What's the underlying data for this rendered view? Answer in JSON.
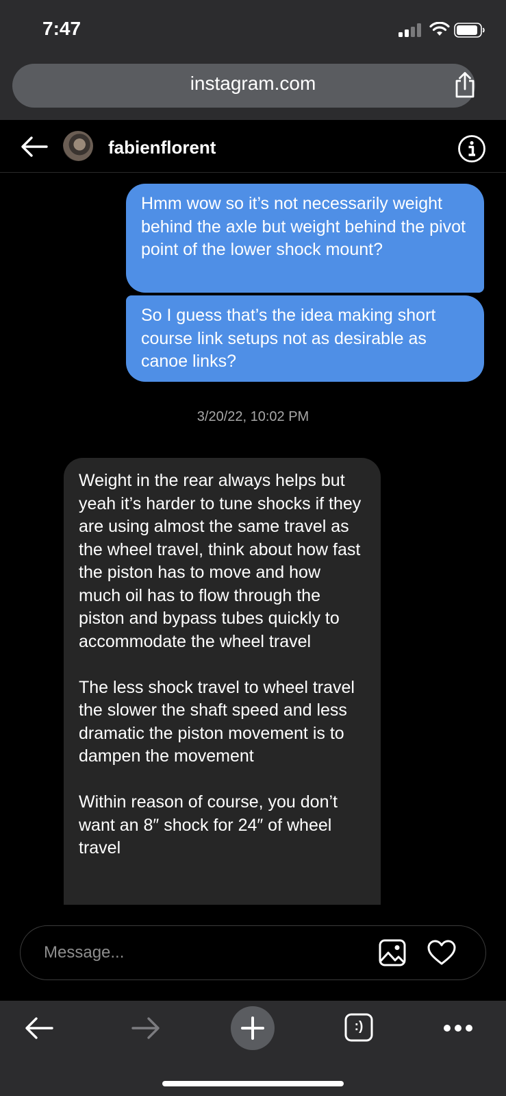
{
  "status_bar": {
    "time": "7:47"
  },
  "browser": {
    "url": "instagram.com"
  },
  "header": {
    "username": "fabienflorent"
  },
  "messages": [
    {
      "sender": "me",
      "text": "Hmm wow so it’s not necessarily weight behind the axle but weight behind the pivot point of the lower shock mount?"
    },
    {
      "sender": "me",
      "text": "So I guess that’s the idea making short course link setups not as desirable as canoe links?"
    },
    {
      "sender": "fabienflorent",
      "text": "Weight in the rear always helps but yeah it’s harder to tune shocks if they are using almost the same travel as the wheel travel, think about how fast the piston has to move and how much oil has to flow through the piston and bypass tubes quickly to accommodate the wheel travel\n\nThe less shock travel to wheel travel the slower the shaft speed and less dramatic the piston movement is to dampen the movement\n\nWithin reason of course, you don’t want an 8″ shock for 24″ of wheel travel"
    }
  ],
  "timestamp": "3/20/22, 10:02 PM",
  "composer": {
    "placeholder": "Message..."
  },
  "toolbar": {
    "tabs_label": ":)"
  },
  "colors": {
    "sent_bubble": "#4f8fe6",
    "received_bubble": "#262626",
    "chrome": "#2c2c2e"
  }
}
